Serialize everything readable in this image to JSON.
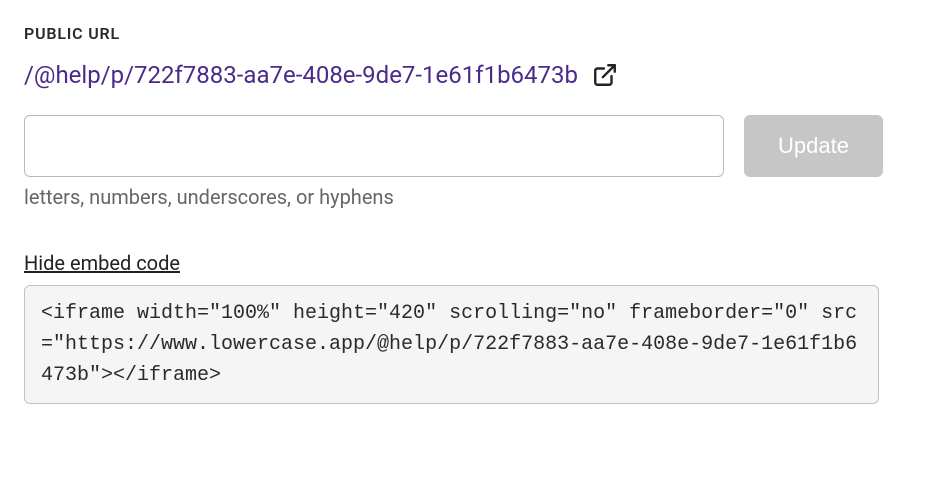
{
  "section_label": "PUBLIC URL",
  "url_link": "/@help/p/722f7883-aa7e-408e-9de7-1e61f1b6473b",
  "input_value": "",
  "update_label": "Update",
  "helper_text": "letters, numbers, underscores, or hyphens",
  "toggle_label": "Hide embed code",
  "embed_code": "<iframe width=\"100%\" height=\"420\" scrolling=\"no\" frameborder=\"0\" src=\"https://www.lowercase.app/@help/p/722f7883-aa7e-408e-9de7-1e61f1b6473b\"></iframe>"
}
